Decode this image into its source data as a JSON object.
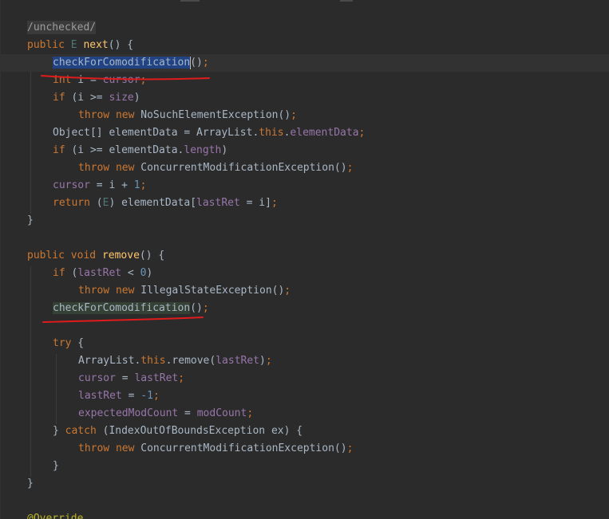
{
  "colors": {
    "background": "#2b2b2b",
    "keyword": "#cc7832",
    "method": "#ffc66d",
    "field": "#9876aa",
    "number": "#6897bb",
    "annotation": "#bbb529",
    "selection": "#214283",
    "usage_highlight": "#344134",
    "annotation_underline": "#e01b1b"
  },
  "code": {
    "l1": {
      "text": "/unchecked/"
    },
    "l2": {
      "public": "public",
      "type_param": "E",
      "name": "next",
      "rest": "() {"
    },
    "l3": {
      "call": "checkForComodification",
      "rest": "()",
      "semi": ";"
    },
    "l4": {
      "int": "int",
      "rest": " i = ",
      "field": "cursor",
      "semi": ";"
    },
    "l5": {
      "if": "if",
      "rest": " (i >= ",
      "field": "size",
      "close": ")"
    },
    "l6": {
      "throw": "throw",
      "new": "new",
      "rest": "NoSuchElementException()",
      "semi": ";"
    },
    "l7": {
      "pre": "Object[] elementData = ArrayList.",
      "this": "this",
      "dot": ".",
      "field": "elementData",
      "semi": ";"
    },
    "l8": {
      "if": "if",
      "pre": " (i >= elementData.",
      "field": "length",
      "close": ")"
    },
    "l9": {
      "throw": "throw",
      "new": "new",
      "rest": "ConcurrentModificationException()",
      "semi": ";"
    },
    "l10": {
      "field": "cursor",
      "rest": " = i + ",
      "num": "1",
      "semi": ";"
    },
    "l11": {
      "return": "return",
      "open": " (",
      "type_param": "E",
      "pre": ") elementData[",
      "field": "lastRet",
      "post": " = i]",
      "semi": ";"
    },
    "l12": {
      "text": "}"
    },
    "l14": {
      "public": "public",
      "void": "void",
      "name": "remove",
      "rest": "() {"
    },
    "l15": {
      "if": "if",
      "open": " (",
      "field": "lastRet",
      "pre": " < ",
      "num": "0",
      "close": ")"
    },
    "l16": {
      "throw": "throw",
      "new": "new",
      "rest": "IllegalStateException()",
      "semi": ";"
    },
    "l17": {
      "call": "checkForComodification",
      "rest": "()",
      "semi": ";"
    },
    "l19": {
      "try": "try",
      "rest": " {"
    },
    "l20": {
      "pre": "ArrayList.",
      "this": "this",
      "dot": ".remove(",
      "field": "lastRet",
      "close": ")",
      "semi": ";"
    },
    "l21": {
      "field": "cursor",
      "rest": " = ",
      "field2": "lastRet",
      "semi": ";"
    },
    "l22": {
      "field": "lastRet",
      "rest": " = ",
      "num": "-1",
      "semi": ";"
    },
    "l23": {
      "field": "expectedModCount",
      "rest": " = ",
      "field2": "modCount",
      "semi": ";"
    },
    "l24": {
      "brace": "} ",
      "catch": "catch",
      "rest": " (IndexOutOfBoundsException ex) {"
    },
    "l25": {
      "throw": "throw",
      "new": "new",
      "rest": "ConcurrentModificationException()",
      "semi": ";"
    },
    "l26": {
      "text": "}"
    },
    "l27": {
      "text": "}"
    },
    "l29": {
      "text": "@Override"
    }
  }
}
